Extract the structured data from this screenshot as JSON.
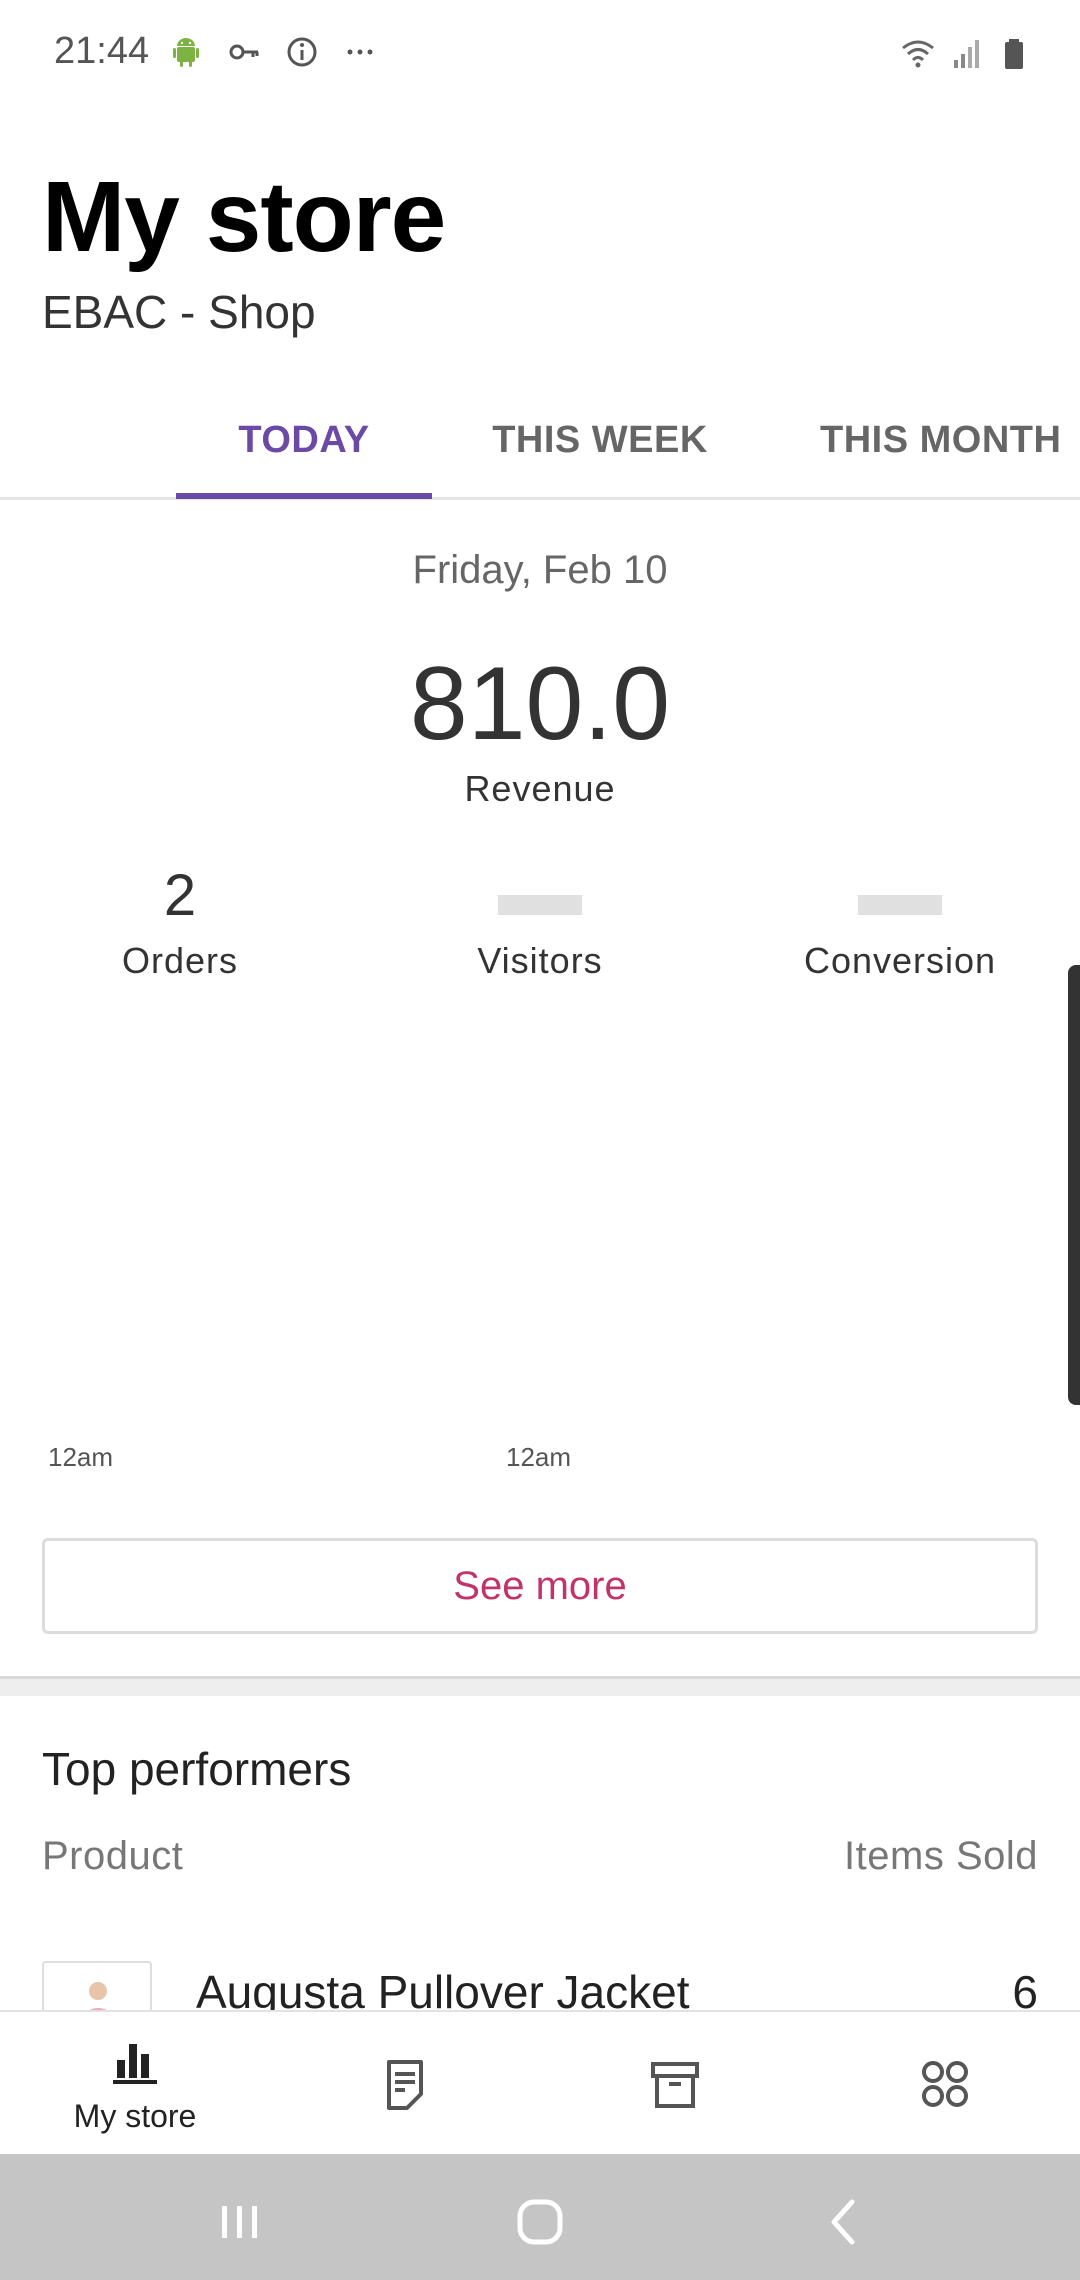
{
  "status_bar": {
    "time": "21:44",
    "left_icons": [
      "android-icon",
      "key-icon",
      "info-icon",
      "more-icon"
    ],
    "right_icons": [
      "wifi-icon",
      "signal-icon",
      "battery-icon"
    ]
  },
  "header": {
    "title": "My store",
    "subtitle": "EBAC - Shop"
  },
  "tabs": [
    {
      "label": "TODAY",
      "active": true
    },
    {
      "label": "THIS WEEK",
      "active": false
    },
    {
      "label": "THIS MONTH",
      "active": false
    }
  ],
  "stats": {
    "date": "Friday, Feb 10",
    "revenue_value": "810.0",
    "revenue_label": "Revenue",
    "orders_value": "2",
    "orders_label": "Orders",
    "visitors_label": "Visitors",
    "conversion_label": "Conversion",
    "axis_labels": [
      "12am",
      "12am"
    ]
  },
  "see_more_label": "See more",
  "top_performers": {
    "title": "Top performers",
    "col_product": "Product",
    "col_items_sold": "Items Sold",
    "rows": [
      {
        "name": "Augusta Pullover Jacket",
        "count": "6"
      }
    ]
  },
  "bottom_nav": {
    "items": [
      {
        "label": "My store",
        "icon": "bar-chart-icon"
      },
      {
        "label": "",
        "icon": "orders-icon"
      },
      {
        "label": "",
        "icon": "products-icon"
      },
      {
        "label": "",
        "icon": "more-menu-icon"
      }
    ]
  },
  "colors": {
    "accent": "#6b4aa6",
    "see_more": "#c2336b",
    "system_nav_bg": "#c5c5c5"
  }
}
